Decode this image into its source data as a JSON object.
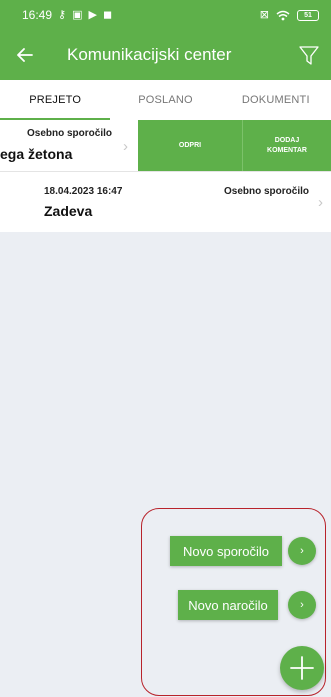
{
  "status_bar": {
    "time": "16:49",
    "battery": "51"
  },
  "app_bar": {
    "title": "Komunikacijski center"
  },
  "tabs": [
    {
      "label": "PREJETO",
      "active": true
    },
    {
      "label": "POSLANO",
      "active": false
    },
    {
      "label": "DOKUMENTI",
      "active": false
    }
  ],
  "messages": [
    {
      "type": "Osebno sporočilo",
      "subject": "ega žetona",
      "actions": {
        "open": "ODPRI",
        "comment_line1": "DODAJ",
        "comment_line2": "KOMENTAR"
      }
    },
    {
      "date": "18.04.2023 16:47",
      "type": "Osebno sporočilo",
      "subject": "Zadeva"
    }
  ],
  "fab_menu": {
    "new_message": "Novo sporočilo",
    "new_order": "Novo naročilo"
  },
  "colors": {
    "primary": "#5eb04a",
    "background": "#ebeef3",
    "highlight": "#b8232b"
  }
}
